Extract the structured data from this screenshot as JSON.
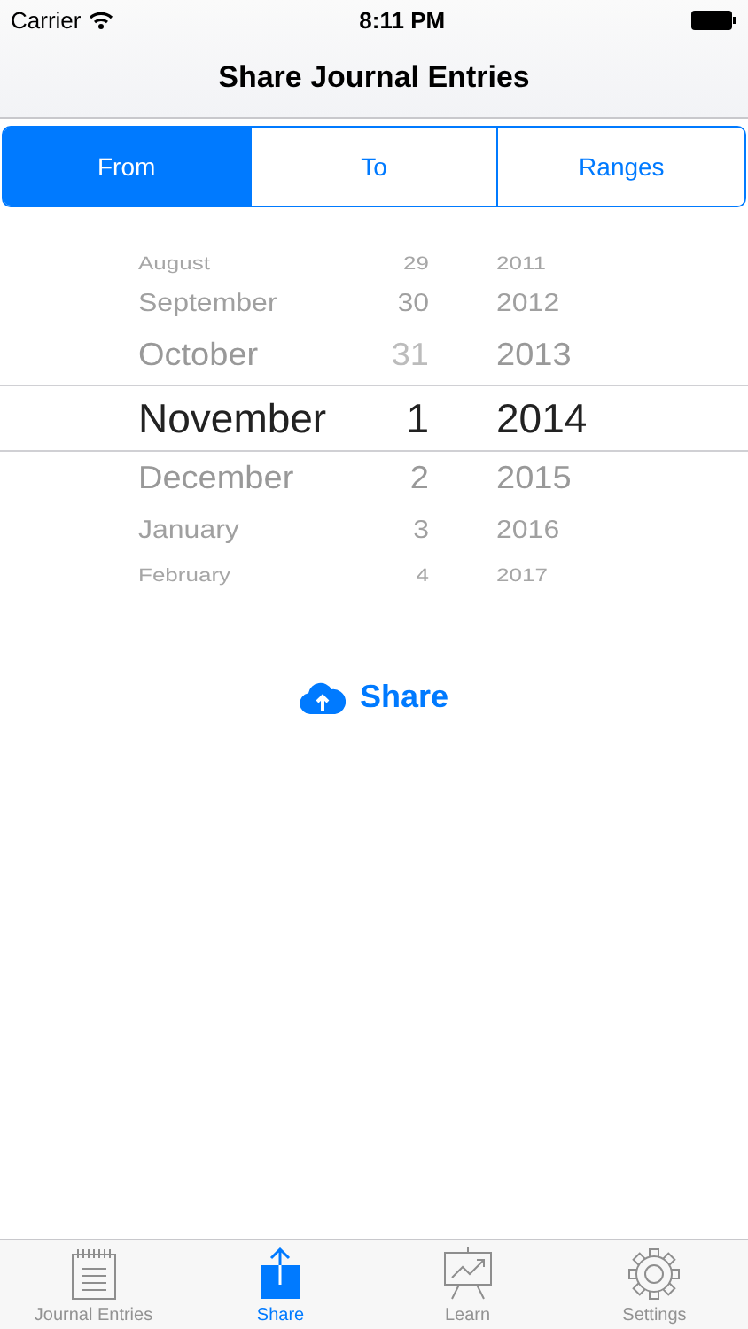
{
  "status_bar": {
    "carrier": "Carrier",
    "time": "8:11 PM"
  },
  "nav_bar": {
    "title": "Share Journal Entries"
  },
  "segments": [
    {
      "label": "From",
      "selected": true
    },
    {
      "label": "To",
      "selected": false
    },
    {
      "label": "Ranges",
      "selected": false
    }
  ],
  "date_picker": {
    "rows": [
      {
        "month": "August",
        "day": "29",
        "year": "2011",
        "selected": false,
        "day_disabled": false
      },
      {
        "month": "September",
        "day": "30",
        "year": "2012",
        "selected": false,
        "day_disabled": false
      },
      {
        "month": "October",
        "day": "31",
        "year": "2013",
        "selected": false,
        "day_disabled": true
      },
      {
        "month": "November",
        "day": "1",
        "year": "2014",
        "selected": true,
        "day_disabled": false
      },
      {
        "month": "December",
        "day": "2",
        "year": "2015",
        "selected": false,
        "day_disabled": false
      },
      {
        "month": "January",
        "day": "3",
        "year": "2016",
        "selected": false,
        "day_disabled": false
      },
      {
        "month": "February",
        "day": "4",
        "year": "2017",
        "selected": false,
        "day_disabled": false
      }
    ]
  },
  "share_button": {
    "label": "Share"
  },
  "tab_bar": [
    {
      "kind": "journal",
      "label": "Journal Entries",
      "selected": false
    },
    {
      "kind": "share",
      "label": "Share",
      "selected": true
    },
    {
      "kind": "learn",
      "label": "Learn",
      "selected": false
    },
    {
      "kind": "settings",
      "label": "Settings",
      "selected": false
    }
  ]
}
